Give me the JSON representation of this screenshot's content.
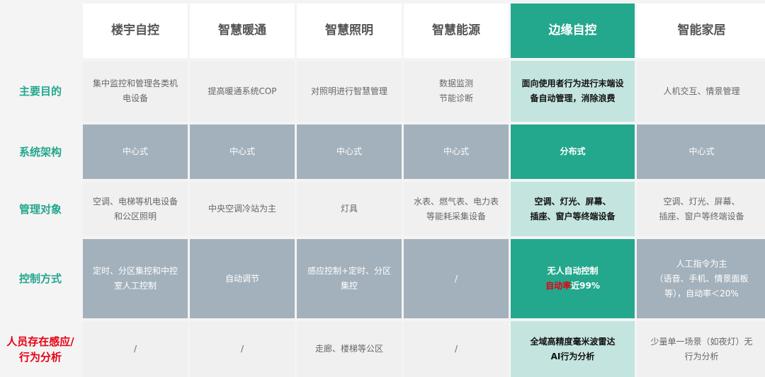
{
  "columns": [
    "楼宇自控",
    "智慧暖通",
    "智慧照明",
    "智慧能源",
    "边缘自控",
    "智能家居"
  ],
  "rows": [
    {
      "label": "主要目的",
      "cells": [
        [
          "集中监控和管理各类机",
          "电设备"
        ],
        [
          "提高暖通系统COP"
        ],
        [
          "对照明进行智慧管理"
        ],
        [
          "数据监测",
          "节能诊断"
        ],
        [
          "面向使用者行为进行末端设",
          "备自动管理，消除浪费"
        ],
        [
          "人机交互、情景管理"
        ]
      ]
    },
    {
      "label": "系统架构",
      "cells": [
        [
          "中心式"
        ],
        [
          "中心式"
        ],
        [
          "中心式"
        ],
        [
          "中心式"
        ],
        [
          "分布式"
        ],
        [
          "中心式"
        ]
      ]
    },
    {
      "label": "管理对象",
      "cells": [
        [
          "空调、电梯等机电设备",
          "和公区照明"
        ],
        [
          "中央空调冷站为主"
        ],
        [
          "灯具"
        ],
        [
          "水表、燃气表、电力表",
          "等能耗采集设备"
        ],
        [
          "空调、灯光、屏幕、",
          "插座、窗户等终端设备"
        ],
        [
          "空调、灯光、屏幕、",
          "插座、窗户等终端设备"
        ]
      ]
    },
    {
      "label": "控制方式",
      "cells": [
        [
          "定时、分区集控和中控",
          "室人工控制"
        ],
        [
          "自动调节"
        ],
        [
          "感应控制+定时、分区",
          "集控"
        ],
        [
          "/"
        ],
        [
          "无人自动控制"
        ],
        [
          "人工指令为主",
          "（语音、手机、情景面板",
          "等），自动率＜20%"
        ]
      ],
      "edge_extra": {
        "red": "自动率",
        "rest": "近99%"
      }
    },
    {
      "label": "人员存在感应/行为分析",
      "cells": [
        [
          "/"
        ],
        [
          "/"
        ],
        [
          "走廊、楼梯等公区"
        ],
        [
          "/"
        ],
        [
          "全域高精度毫米波雷达",
          "AI行为分析"
        ],
        [
          "少量单一场景（如夜灯）无",
          "行为分析"
        ]
      ]
    }
  ],
  "colors": {
    "accent": "#23a78d",
    "accent_light": "#c4e5df",
    "dark_row": "#a3b1bc",
    "light_row": "#f0f0f0",
    "red": "#e60012"
  }
}
